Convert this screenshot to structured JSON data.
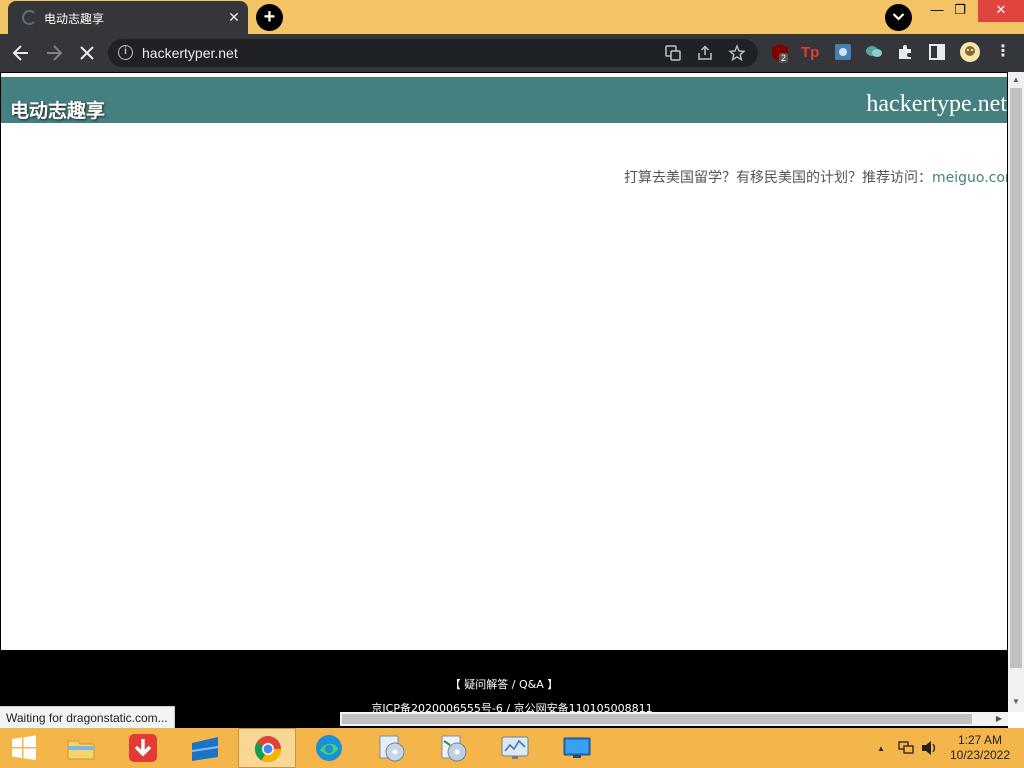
{
  "browser": {
    "tab": {
      "title": "电动志趣享",
      "close_glyph": "✕"
    },
    "new_tab_glyph": "+",
    "window": {
      "minimize": "—",
      "maximize": "❐",
      "close": "✕"
    },
    "address_bar": {
      "url": "hackertyper.net"
    },
    "extensions": [
      {
        "name": "ublock-icon",
        "badge": "2"
      },
      {
        "name": "tp-icon",
        "label": "Tp"
      }
    ],
    "status_text": "Waiting for dragonstatic.com..."
  },
  "page": {
    "brand": "电动志趣享",
    "domain": "hackertype.net",
    "promo": {
      "text": "打算去美国留学？有移民美国的计划？推荐访问：",
      "link": "meiguo.com"
    },
    "footer": {
      "qa": "【 疑问解答 / Q&A 】",
      "icp": "京ICP备2020006555号-6 / 京公网安备110105008811"
    }
  },
  "taskbar": {
    "clock_time": "1:27 AM",
    "clock_date": "10/23/2022"
  },
  "colors": {
    "titlebar": "#f2c466",
    "toolbar": "#35363a",
    "header_teal": "#44807f",
    "taskbar": "#f4b64b"
  }
}
